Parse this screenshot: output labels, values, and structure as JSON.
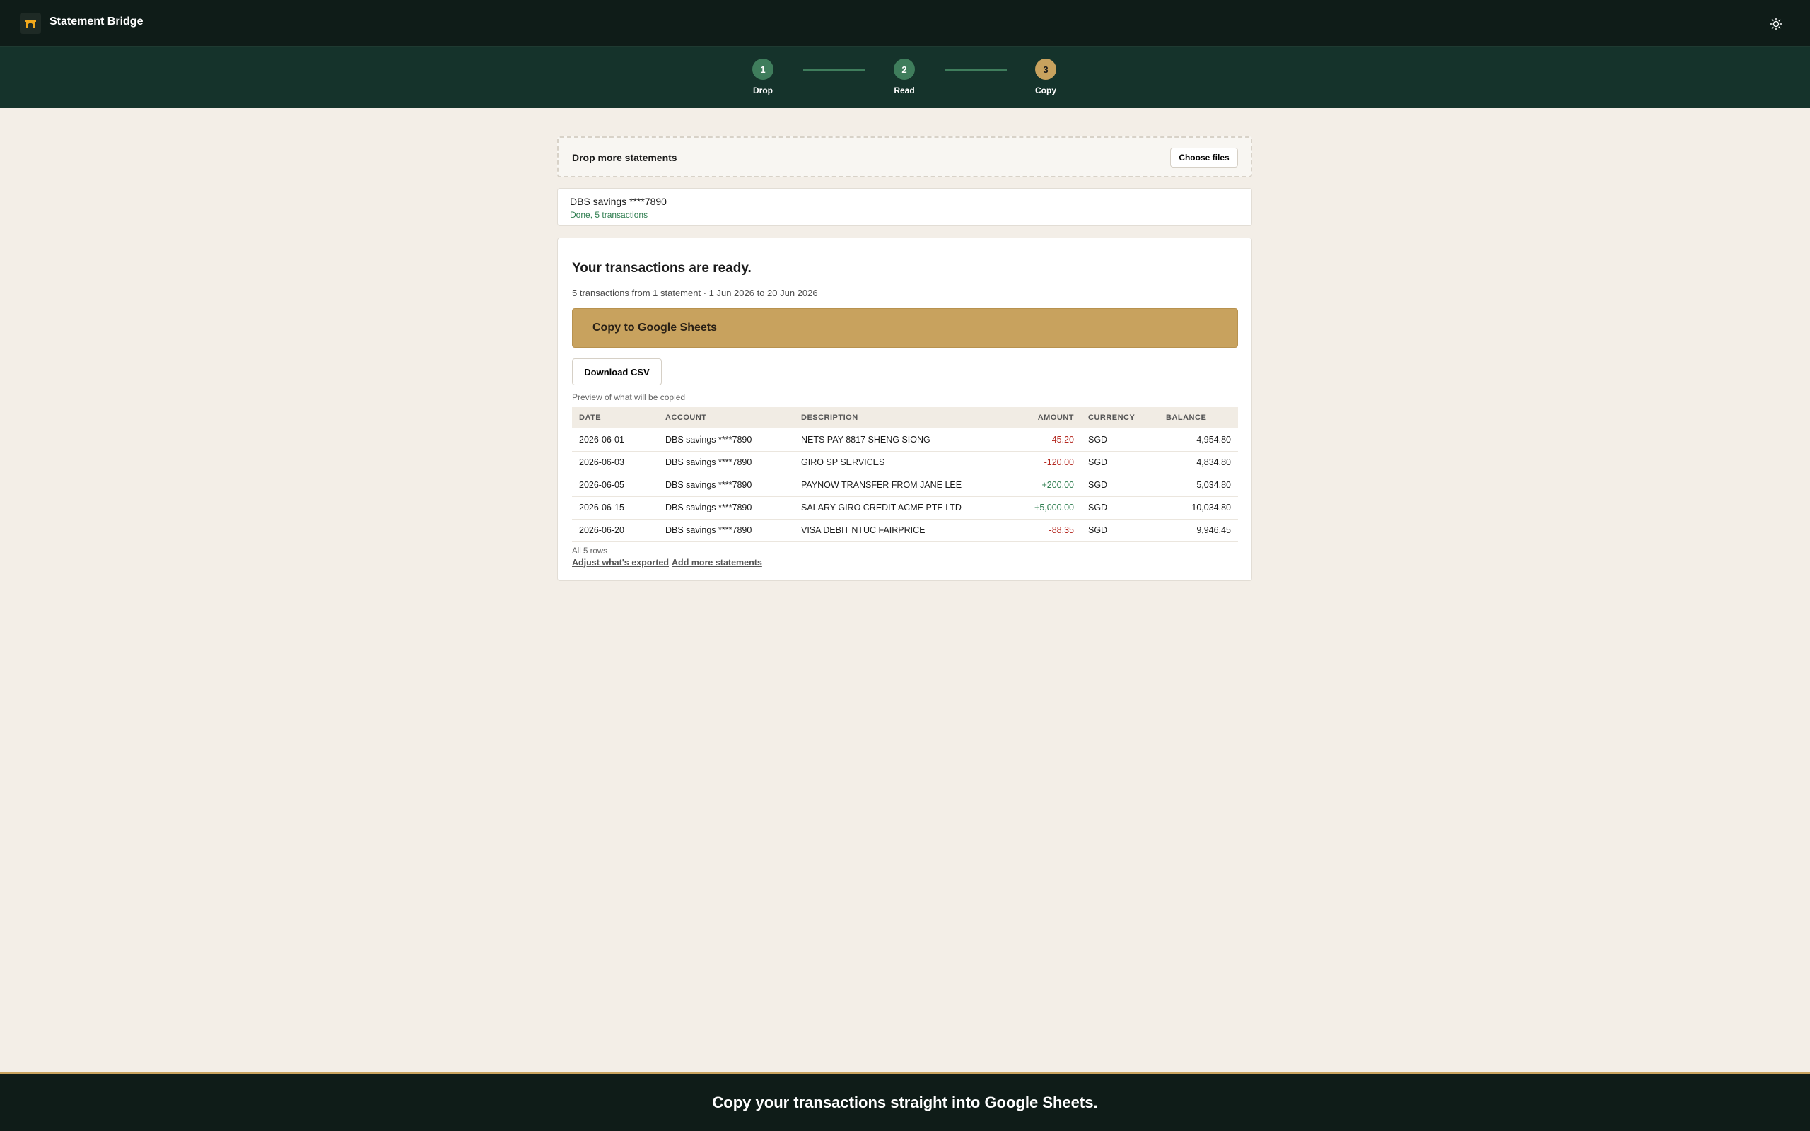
{
  "app": {
    "title": "Statement Bridge",
    "logo_icon": "bridge-logo-icon",
    "theme_icon": "sun-icon"
  },
  "stepper": {
    "steps": [
      {
        "number": "1",
        "label": "Drop",
        "state": "done"
      },
      {
        "number": "2",
        "label": "Read",
        "state": "done"
      },
      {
        "number": "3",
        "label": "Copy",
        "state": "active"
      }
    ]
  },
  "dropzone": {
    "title": "Drop more statements",
    "button_label": "Choose files"
  },
  "statement": {
    "name": "DBS savings ****7890",
    "status": "Done, 5 transactions"
  },
  "results": {
    "heading": "Your transactions are ready.",
    "summary": "5 transactions from 1 statement · 1 Jun 2026 to 20 Jun 2026",
    "copy_button": "Copy to Google Sheets",
    "csv_button": "Download CSV",
    "preview_label": "Preview of what will be copied",
    "columns": [
      "DATE",
      "ACCOUNT",
      "DESCRIPTION",
      "AMOUNT",
      "CURRENCY",
      "BALANCE"
    ],
    "rows": [
      {
        "date": "2026-06-01",
        "account": "DBS savings ****7890",
        "description": "NETS PAY 8817 SHENG SIONG",
        "amount": "-45.20",
        "currency": "SGD",
        "balance": "4,954.80"
      },
      {
        "date": "2026-06-03",
        "account": "DBS savings ****7890",
        "description": "GIRO SP SERVICES",
        "amount": "-120.00",
        "currency": "SGD",
        "balance": "4,834.80"
      },
      {
        "date": "2026-06-05",
        "account": "DBS savings ****7890",
        "description": "PAYNOW TRANSFER FROM JANE LEE",
        "amount": "+200.00",
        "currency": "SGD",
        "balance": "5,034.80"
      },
      {
        "date": "2026-06-15",
        "account": "DBS savings ****7890",
        "description": "SALARY GIRO CREDIT ACME PTE LTD",
        "amount": "+5,000.00",
        "currency": "SGD",
        "balance": "10,034.80"
      },
      {
        "date": "2026-06-20",
        "account": "DBS savings ****7890",
        "description": "VISA DEBIT NTUC FAIRPRICE",
        "amount": "-88.35",
        "currency": "SGD",
        "balance": "9,946.45"
      }
    ],
    "row_count": "All 5 rows",
    "adjust_link": "Adjust what's exported",
    "add_link": "Add more statements"
  },
  "footer": {
    "text": "Copy your transactions straight into Google Sheets."
  },
  "colors": {
    "header_bg": "#0f1c18",
    "stepper_bg": "#15332b",
    "accent_gold": "#c8a25e",
    "done_green": "#3f7d5c",
    "negative": "#b3261e",
    "positive": "#2e7d4f"
  }
}
